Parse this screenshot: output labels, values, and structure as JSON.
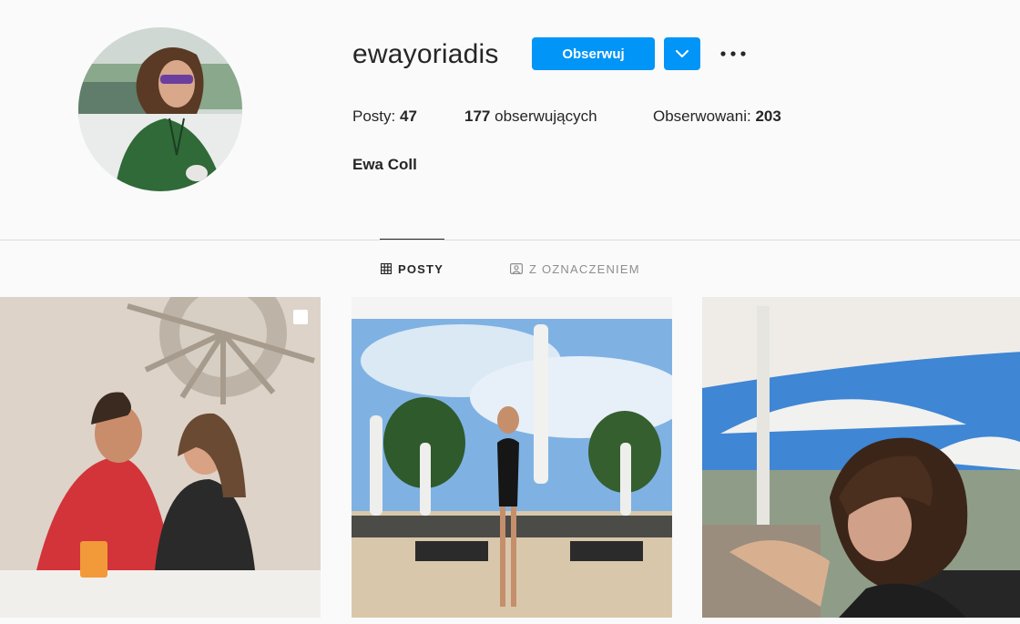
{
  "profile": {
    "username": "ewayoriadis",
    "full_name": "Ewa Coll",
    "follow_label": "Obserwuj",
    "avatar_icon": "profile-photo",
    "stats": {
      "posts_label": "Posty:",
      "posts_count": "47",
      "followers_count": "177",
      "followers_label": "obserwujących",
      "following_label": "Obserwowani:",
      "following_count": "203"
    }
  },
  "tabs": [
    {
      "label": "POSTY",
      "icon": "grid-icon",
      "active": true
    },
    {
      "label": "Z OZNACZENIEM",
      "icon": "tagged-icon",
      "active": false
    }
  ],
  "posts": [
    {
      "description_icon": "couple-photo",
      "multi": true
    },
    {
      "description_icon": "beach-photo",
      "multi": false
    },
    {
      "description_icon": "umbrella-photo",
      "multi": false
    }
  ],
  "colors": {
    "accent": "#0095f6",
    "text": "#262626",
    "muted": "#8e8e8e",
    "background": "#fafafa"
  }
}
